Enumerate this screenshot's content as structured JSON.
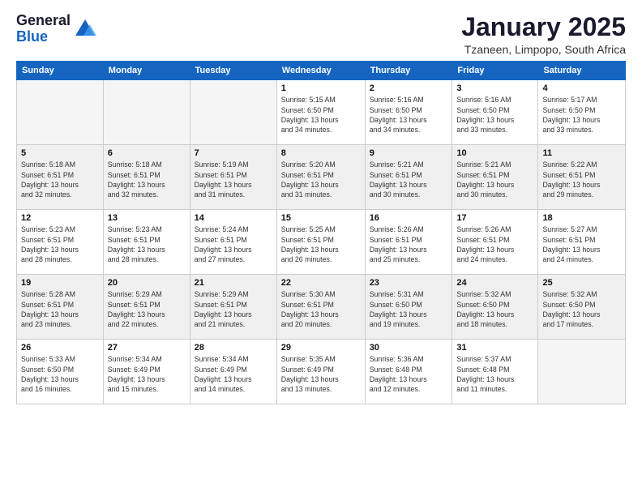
{
  "logo": {
    "general": "General",
    "blue": "Blue"
  },
  "header": {
    "title": "January 2025",
    "subtitle": "Tzaneen, Limpopo, South Africa"
  },
  "weekdays": [
    "Sunday",
    "Monday",
    "Tuesday",
    "Wednesday",
    "Thursday",
    "Friday",
    "Saturday"
  ],
  "weeks": [
    [
      {
        "day": "",
        "detail": ""
      },
      {
        "day": "",
        "detail": ""
      },
      {
        "day": "",
        "detail": ""
      },
      {
        "day": "1",
        "detail": "Sunrise: 5:15 AM\nSunset: 6:50 PM\nDaylight: 13 hours\nand 34 minutes."
      },
      {
        "day": "2",
        "detail": "Sunrise: 5:16 AM\nSunset: 6:50 PM\nDaylight: 13 hours\nand 34 minutes."
      },
      {
        "day": "3",
        "detail": "Sunrise: 5:16 AM\nSunset: 6:50 PM\nDaylight: 13 hours\nand 33 minutes."
      },
      {
        "day": "4",
        "detail": "Sunrise: 5:17 AM\nSunset: 6:50 PM\nDaylight: 13 hours\nand 33 minutes."
      }
    ],
    [
      {
        "day": "5",
        "detail": "Sunrise: 5:18 AM\nSunset: 6:51 PM\nDaylight: 13 hours\nand 32 minutes."
      },
      {
        "day": "6",
        "detail": "Sunrise: 5:18 AM\nSunset: 6:51 PM\nDaylight: 13 hours\nand 32 minutes."
      },
      {
        "day": "7",
        "detail": "Sunrise: 5:19 AM\nSunset: 6:51 PM\nDaylight: 13 hours\nand 31 minutes."
      },
      {
        "day": "8",
        "detail": "Sunrise: 5:20 AM\nSunset: 6:51 PM\nDaylight: 13 hours\nand 31 minutes."
      },
      {
        "day": "9",
        "detail": "Sunrise: 5:21 AM\nSunset: 6:51 PM\nDaylight: 13 hours\nand 30 minutes."
      },
      {
        "day": "10",
        "detail": "Sunrise: 5:21 AM\nSunset: 6:51 PM\nDaylight: 13 hours\nand 30 minutes."
      },
      {
        "day": "11",
        "detail": "Sunrise: 5:22 AM\nSunset: 6:51 PM\nDaylight: 13 hours\nand 29 minutes."
      }
    ],
    [
      {
        "day": "12",
        "detail": "Sunrise: 5:23 AM\nSunset: 6:51 PM\nDaylight: 13 hours\nand 28 minutes."
      },
      {
        "day": "13",
        "detail": "Sunrise: 5:23 AM\nSunset: 6:51 PM\nDaylight: 13 hours\nand 28 minutes."
      },
      {
        "day": "14",
        "detail": "Sunrise: 5:24 AM\nSunset: 6:51 PM\nDaylight: 13 hours\nand 27 minutes."
      },
      {
        "day": "15",
        "detail": "Sunrise: 5:25 AM\nSunset: 6:51 PM\nDaylight: 13 hours\nand 26 minutes."
      },
      {
        "day": "16",
        "detail": "Sunrise: 5:26 AM\nSunset: 6:51 PM\nDaylight: 13 hours\nand 25 minutes."
      },
      {
        "day": "17",
        "detail": "Sunrise: 5:26 AM\nSunset: 6:51 PM\nDaylight: 13 hours\nand 24 minutes."
      },
      {
        "day": "18",
        "detail": "Sunrise: 5:27 AM\nSunset: 6:51 PM\nDaylight: 13 hours\nand 24 minutes."
      }
    ],
    [
      {
        "day": "19",
        "detail": "Sunrise: 5:28 AM\nSunset: 6:51 PM\nDaylight: 13 hours\nand 23 minutes."
      },
      {
        "day": "20",
        "detail": "Sunrise: 5:29 AM\nSunset: 6:51 PM\nDaylight: 13 hours\nand 22 minutes."
      },
      {
        "day": "21",
        "detail": "Sunrise: 5:29 AM\nSunset: 6:51 PM\nDaylight: 13 hours\nand 21 minutes."
      },
      {
        "day": "22",
        "detail": "Sunrise: 5:30 AM\nSunset: 6:51 PM\nDaylight: 13 hours\nand 20 minutes."
      },
      {
        "day": "23",
        "detail": "Sunrise: 5:31 AM\nSunset: 6:50 PM\nDaylight: 13 hours\nand 19 minutes."
      },
      {
        "day": "24",
        "detail": "Sunrise: 5:32 AM\nSunset: 6:50 PM\nDaylight: 13 hours\nand 18 minutes."
      },
      {
        "day": "25",
        "detail": "Sunrise: 5:32 AM\nSunset: 6:50 PM\nDaylight: 13 hours\nand 17 minutes."
      }
    ],
    [
      {
        "day": "26",
        "detail": "Sunrise: 5:33 AM\nSunset: 6:50 PM\nDaylight: 13 hours\nand 16 minutes."
      },
      {
        "day": "27",
        "detail": "Sunrise: 5:34 AM\nSunset: 6:49 PM\nDaylight: 13 hours\nand 15 minutes."
      },
      {
        "day": "28",
        "detail": "Sunrise: 5:34 AM\nSunset: 6:49 PM\nDaylight: 13 hours\nand 14 minutes."
      },
      {
        "day": "29",
        "detail": "Sunrise: 5:35 AM\nSunset: 6:49 PM\nDaylight: 13 hours\nand 13 minutes."
      },
      {
        "day": "30",
        "detail": "Sunrise: 5:36 AM\nSunset: 6:48 PM\nDaylight: 13 hours\nand 12 minutes."
      },
      {
        "day": "31",
        "detail": "Sunrise: 5:37 AM\nSunset: 6:48 PM\nDaylight: 13 hours\nand 11 minutes."
      },
      {
        "day": "",
        "detail": ""
      }
    ]
  ]
}
